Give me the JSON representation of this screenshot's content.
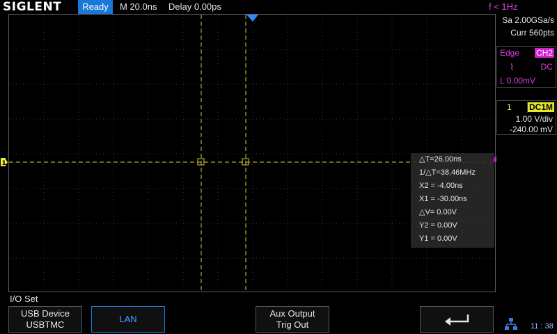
{
  "header": {
    "brand": "SIGLENT",
    "status": "Ready",
    "timebase": "M 20.0ns",
    "delay": "Delay 0.00ps",
    "frequency": "f < 1Hz"
  },
  "acquisition": {
    "sample_rate": "Sa 2.00GSa/s",
    "memory_depth": "Curr 560pts"
  },
  "trigger": {
    "type": "Edge",
    "source": "CH2",
    "slope_symbol": "⌇",
    "coupling": "DC",
    "level": "L  0.00mV"
  },
  "channel": {
    "number": "1",
    "coupling": "DC1M",
    "scale": "1.00 V/div",
    "offset": "-240.00 mV"
  },
  "cursors": {
    "delta_t": "△T=26.00ns",
    "inv_delta_t": "1/△T=38.46MHz",
    "x2": "X2 = -4.00ns",
    "x1": "X1 = -30.00ns",
    "delta_v": "△V= 0.00V",
    "y2": "Y2 = 0.00V",
    "y1": "Y1 = 0.00V"
  },
  "menu": {
    "title": "I/O Set",
    "softkeys": [
      {
        "line1": "USB Device",
        "line2": "USBTMC"
      },
      {
        "line1": "LAN",
        "line2": ""
      },
      {
        "line1": "Aux Output",
        "line2": "Trig Out"
      }
    ]
  },
  "clock": "11 : 38",
  "colors": {
    "status_bg": "#1a78d8",
    "channel1": "#f0f040",
    "trigger": "#e040e0",
    "grid": "#5a5a5a",
    "cursor": "#d8d040"
  },
  "icons": {
    "back": "back-arrow-icon",
    "network": "network-icon",
    "trigger_marker": "trigger-position-marker",
    "channel_marker": "channel-offset-marker"
  }
}
